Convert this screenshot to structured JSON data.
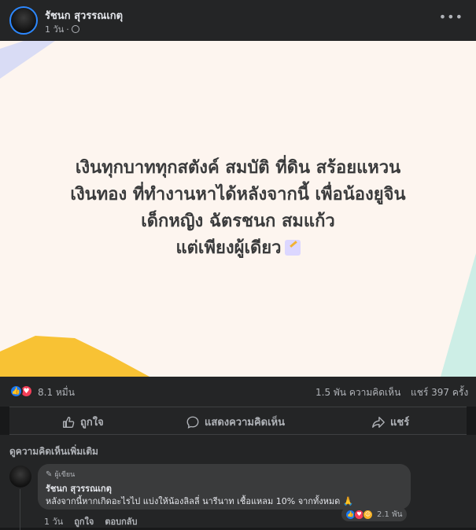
{
  "post": {
    "author": "รัชนก สุวรรณเกตุ",
    "time": "1 วัน",
    "more_icon": "more-dots-icon",
    "card_lines": [
      "เงินทุกบาททุกสตังค์ สมบัติ ที่ดิน สร้อยแหวน",
      "เงินทอง ที่ทำงานหาได้หลังจากนี้ เพื่อน้องยูจิน",
      "เด็กหญิง ฉัตรชนก สมแก้ว",
      "แต่เพียงผู้เดียว"
    ],
    "card_background": "#fdf5ef"
  },
  "stats": {
    "reactions": "8.1 หมื่น",
    "comments": "1.5 พัน ความคิดเห็น",
    "shares": "แชร์ 397 ครั้ง"
  },
  "actions": {
    "like": "ถูกใจ",
    "comment": "แสดงความคิดเห็น",
    "share": "แชร์"
  },
  "comments_section": {
    "view_more": "ดูความคิดเห็นเพิ่มเติม",
    "comment": {
      "badge": "ผู้เขียน",
      "author": "รัชนก สุวรรณเกตุ",
      "text": "หลังจากนี้หากเกิดอะไรไป แบ่งให้น้องลิลลี่ นารีนาท เชื้อแหลม 10% จากทั้งหมด",
      "reaction_count": "2.1 พัน",
      "time": "1 วัน",
      "like": "ถูกใจ",
      "reply": "ตอบกลับ"
    }
  },
  "colors": {
    "accent": "#1877f2",
    "love": "#f33e58",
    "background": "#18191a",
    "surface": "#242526"
  }
}
